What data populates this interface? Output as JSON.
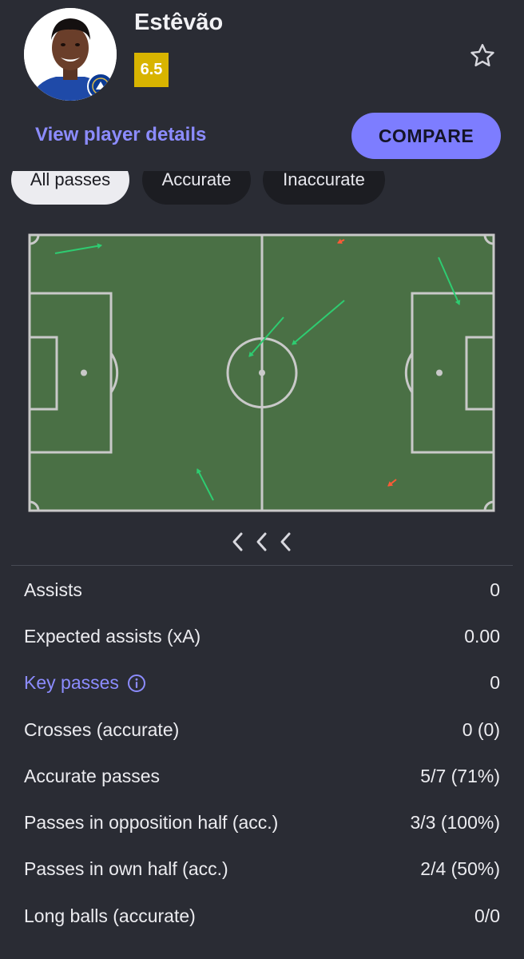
{
  "player": {
    "name": "Estêvão",
    "rating": "6.5",
    "rating_color": "#d8b400"
  },
  "header": {
    "view_details_label": "View player details",
    "compare_label": "COMPARE",
    "accent_color": "#8c8cff"
  },
  "filters": [
    {
      "label": "All passes",
      "active": true
    },
    {
      "label": "Accurate",
      "active": false
    },
    {
      "label": "Inaccurate",
      "active": false
    }
  ],
  "pitch": {
    "pitch_color": "#4a7045",
    "accurate_color": "#2ecc71",
    "inaccurate_color": "#ff5a36"
  },
  "stats": [
    {
      "label": "Assists",
      "value": "0"
    },
    {
      "label": "Expected assists (xA)",
      "value": "0.00"
    },
    {
      "label": "Key passes",
      "value": "0",
      "info": true
    },
    {
      "label": "Crosses (accurate)",
      "value": "0 (0)"
    },
    {
      "label": "Accurate passes",
      "value": "5/7 (71%)"
    },
    {
      "label": "Passes in opposition half (acc.)",
      "value": "3/3 (100%)"
    },
    {
      "label": "Passes in own half (acc.)",
      "value": "2/4 (50%)"
    },
    {
      "label": "Long balls (accurate)",
      "value": "0/0"
    }
  ],
  "icons": {
    "favorite": "star-outline-icon",
    "info": "info-circle-icon",
    "pager": "chevron-left-icon"
  }
}
